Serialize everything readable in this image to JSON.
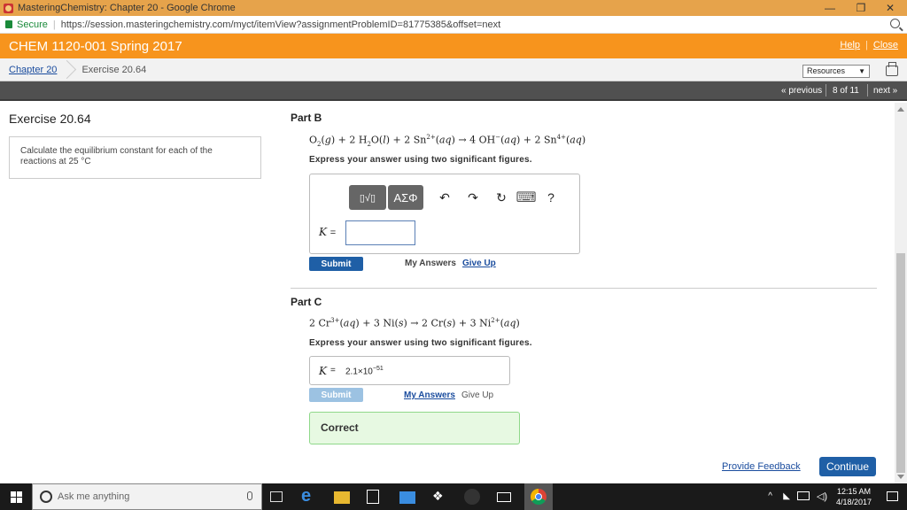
{
  "browser": {
    "window_title": "MasteringChemistry: Chapter 20 - Google Chrome",
    "secure_label": "Secure",
    "url": "https://session.masteringchemistry.com/myct/itemView?assignmentProblemID=81775385&offset=next",
    "minimize": "—",
    "maximize": "❐",
    "close": "✕"
  },
  "header": {
    "course": "CHEM 1120-001 Spring 2017",
    "help": "Help",
    "close": "Close"
  },
  "breadcrumb": {
    "chapter": "Chapter 20",
    "exercise": "Exercise 20.64",
    "resources": "Resources",
    "resources_arrow": "▼"
  },
  "nav": {
    "previous": "« previous",
    "position": "8 of 11",
    "next": "next »"
  },
  "exercise": {
    "title": "Exercise 20.64",
    "instruction_prefix": "Calculate the equilibrium constant for each of the reactions at 25 ",
    "instruction_unit": "°C"
  },
  "partB": {
    "title": "Part B",
    "instruction": "Express your answer using two significant figures.",
    "toolbar": {
      "templates": "▯√▯",
      "greek": "ΑΣΦ",
      "undo": "↶",
      "redo": "↷",
      "reset": "↻",
      "keyboard": "⌨",
      "help": "?"
    },
    "k_label": "K",
    "equals": "=",
    "submit": "Submit",
    "my_answers": "My Answers",
    "give_up": "Give Up"
  },
  "partC": {
    "title": "Part C",
    "instruction": "Express your answer using two significant figures.",
    "k_label": "K",
    "equals": "=",
    "answer_base": "2.1×10",
    "answer_exp": "−51",
    "submit": "Submit",
    "my_answers": "My Answers",
    "give_up": "Give Up",
    "status": "Correct"
  },
  "footer": {
    "feedback": "Provide Feedback",
    "continue": "Continue"
  },
  "taskbar": {
    "search_placeholder": "Ask me anything",
    "time": "12:15 AM",
    "date": "4/18/2017"
  },
  "colors": {
    "header_orange": "#f7941d",
    "titlebar_orange": "#e6a34b",
    "submit_blue": "#1f5fa6",
    "submit_disabled": "#9cc2e2",
    "correct_bg": "#e7f9e2",
    "correct_border": "#8fd88a"
  }
}
